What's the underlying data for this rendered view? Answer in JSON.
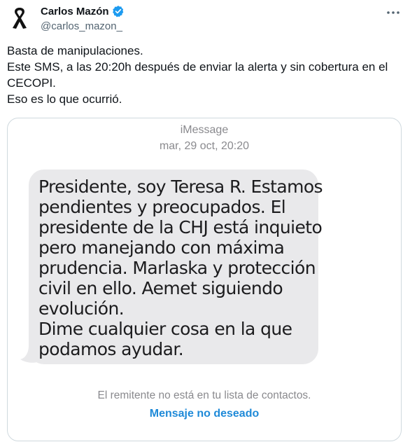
{
  "author": {
    "name": "Carlos Mazón",
    "handle": "@carlos_mazon_",
    "verified": true,
    "avatar_icon": "black-ribbon-icon",
    "verified_color": "#1d9bf0"
  },
  "menu": {
    "icon": "more-horizontal-icon"
  },
  "tweet": {
    "lines": [
      "Basta de manipulaciones.",
      "Este SMS, a las 20:20h después de enviar la alerta y sin cobertura en el",
      "CECOPI.",
      "Eso es lo que ocurrió."
    ]
  },
  "media": {
    "service_label": "iMessage",
    "timestamp": "mar, 29 oct, 20:20",
    "bubble_lines": [
      "Presidente, soy Teresa R. Estamos",
      "pendientes y preocupados. El",
      "presidente de la CHJ está inquieto",
      "pero manejando con máxima",
      "prudencia. Marlaska y protección",
      "civil en ello. Aemet siguiendo",
      "evolución.",
      "Dime cualquier cosa en la que",
      "podamos ayudar."
    ],
    "sender_note": "El remitente no está en tu lista de contactos.",
    "junk_link": "Mensaje no deseado",
    "bubble_color": "#e9e9eb",
    "link_color": "#1f8ad8"
  }
}
